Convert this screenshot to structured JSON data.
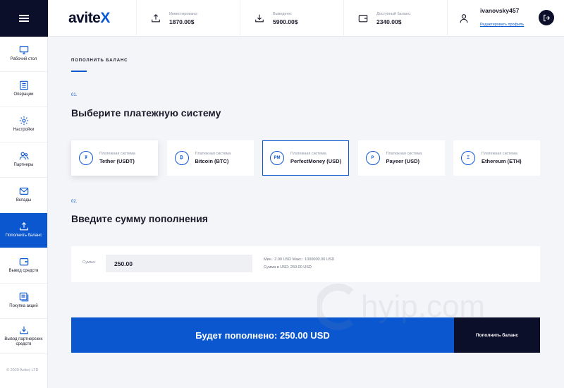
{
  "sidebar": {
    "items": [
      {
        "label": "Рабочий стол",
        "icon": "monitor-icon",
        "active": false
      },
      {
        "label": "Операции",
        "icon": "list-icon",
        "active": false
      },
      {
        "label": "Настройки",
        "icon": "gear-icon",
        "active": false
      },
      {
        "label": "Партнеры",
        "icon": "users-icon",
        "active": false
      },
      {
        "label": "Вклады",
        "icon": "mail-icon",
        "active": false
      },
      {
        "label": "Пополнить баланс",
        "icon": "upload-icon",
        "active": true
      },
      {
        "label": "Вывод средств",
        "icon": "wallet-icon",
        "active": false
      },
      {
        "label": "Покупка акций",
        "icon": "shares-icon",
        "active": false
      },
      {
        "label": "Вывод партнерских средств",
        "icon": "download-icon",
        "active": false
      }
    ],
    "copyright": "© 2020 Avitex LTD"
  },
  "header": {
    "logo_main": "avite",
    "logo_accent": "X",
    "stats": [
      {
        "label": "Инвестировано:",
        "value": "1870.00$",
        "icon": "upload-icon"
      },
      {
        "label": "Выведено:",
        "value": "5900.00$",
        "icon": "download-icon"
      },
      {
        "label": "Доступный баланс:",
        "value": "2340.00$",
        "icon": "wallet-icon"
      }
    ],
    "username": "ivanovsky457",
    "edit_profile": "Редактировать профиль"
  },
  "main": {
    "section_title": "ПОПОЛНИТЬ БАЛАНС",
    "step1_num": "01.",
    "step1_title": "Выберите платежную систему",
    "payment_label": "Платежная система",
    "payments": [
      {
        "name": "Tether (USDT)",
        "abbr": "₮"
      },
      {
        "name": "Bitcoin (BTC)",
        "abbr": "₿"
      },
      {
        "name": "PerfectMoney (USD)",
        "abbr": "PM"
      },
      {
        "name": "Payeer (USD)",
        "abbr": "P"
      },
      {
        "name": "Ethereum (ETH)",
        "abbr": "Ξ"
      }
    ],
    "selected_index": 2,
    "step2_num": "02.",
    "step2_title": "Введите сумму пополнения",
    "amount_label": "Сумма:",
    "amount_value": "250.00",
    "limits_line1": "Мин.: 2.00 USD   Макс.: 1000000.00 USD",
    "limits_line2": "Сумма в USD: 250.00 USD",
    "total_text": "Будет пополнено: 250.00 USD",
    "submit_label": "Пополнить баланс"
  },
  "watermark": "hyip.com",
  "colors": {
    "accent": "#0b57d0",
    "dark": "#0c0f2a",
    "background": "#f4f5f8"
  }
}
